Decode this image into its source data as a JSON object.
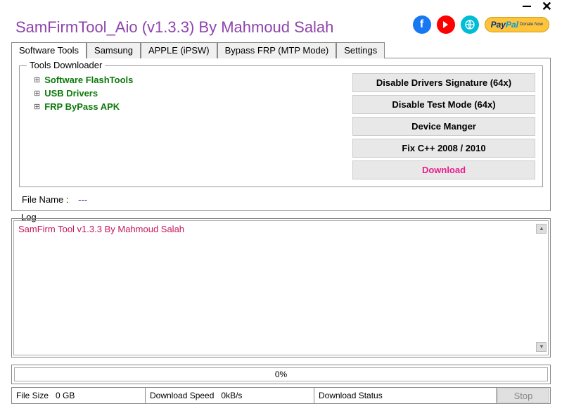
{
  "window": {
    "title": "SamFirmTool_Aio (v1.3.3) By Mahmoud Salah"
  },
  "tabs": [
    "Software Tools",
    "Samsung",
    "APPLE (iPSW)",
    "Bypass FRP (MTP Mode)",
    "Settings"
  ],
  "activeTab": 0,
  "toolsDownloader": {
    "legend": "Tools Downloader",
    "items": [
      "Software FlashTools",
      "USB Drivers",
      "FRP ByPass APK"
    ]
  },
  "actionButtons": [
    "Disable Drivers Signature (64x)",
    "Disable Test Mode (64x)",
    "Device Manger",
    "Fix C++ 2008 / 2010",
    "Download"
  ],
  "fileName": {
    "label": "File Name :",
    "value": "---"
  },
  "log": {
    "label": "Log",
    "text": "SamFirm Tool v1.3.3 By Mahmoud Salah"
  },
  "progress": "0%",
  "statusBar": {
    "fileSizeLabel": "File Size",
    "fileSizeValue": "0 GB",
    "downloadSpeedLabel": "Download Speed",
    "downloadSpeedValue": "0kB/s",
    "downloadStatusLabel": "Download Status",
    "downloadStatusValue": ""
  },
  "stopLabel": "Stop",
  "social": {
    "paypal": "PayPal",
    "paypalSub": "Donate Now"
  }
}
